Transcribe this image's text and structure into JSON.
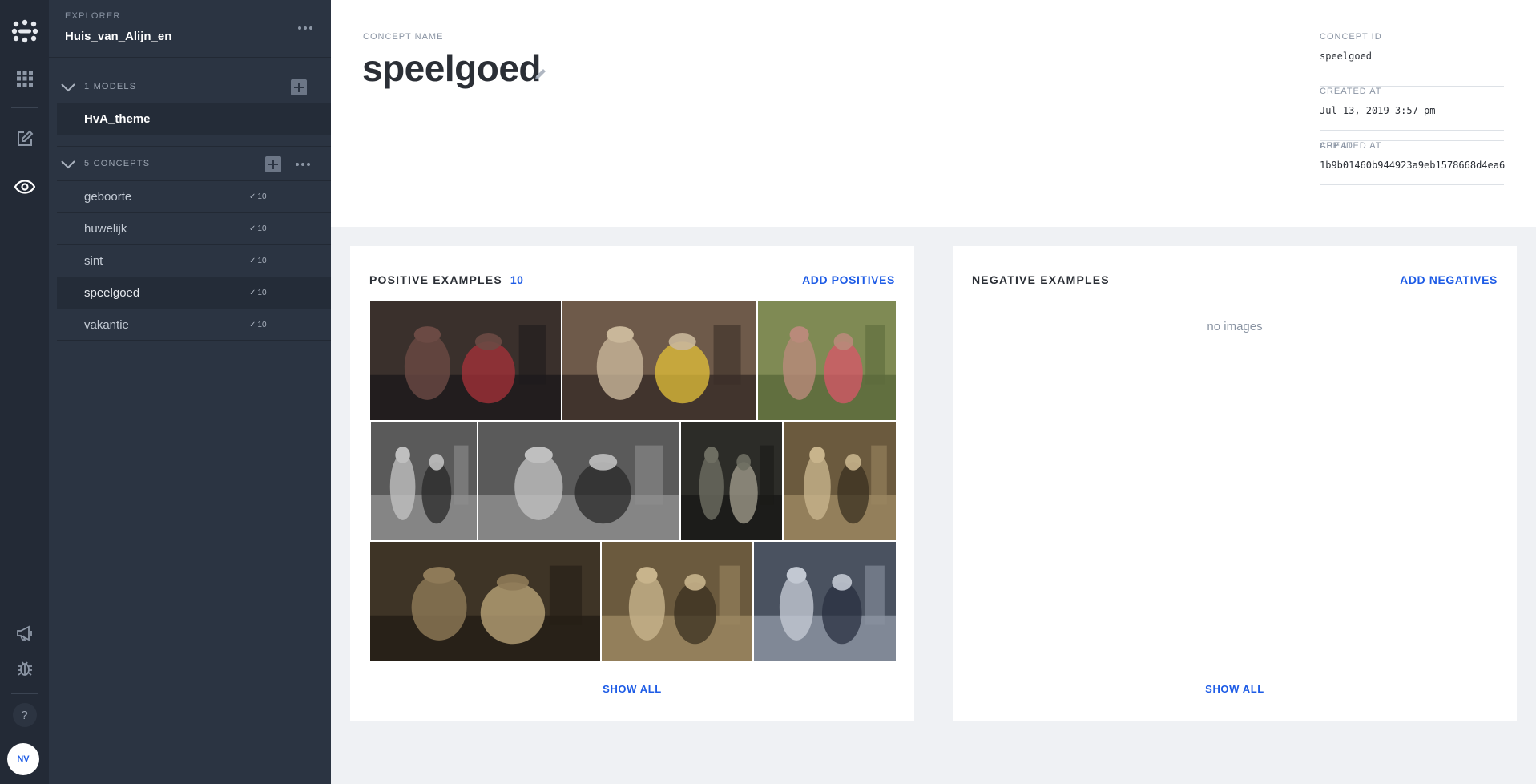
{
  "rail": {
    "icons": [
      "clarifai-logo-icon",
      "apps-grid-icon",
      "edit-icon",
      "eye-icon",
      "megaphone-icon",
      "bug-icon"
    ],
    "help_label": "?",
    "avatar_initials": "NV"
  },
  "explorer": {
    "label": "EXPLORER",
    "app_name": "Huis_van_Alijn_en",
    "models_header": "1 MODELS",
    "models": [
      {
        "name": "HvA_theme"
      }
    ],
    "concepts_header": "5 CONCEPTS",
    "concepts": [
      {
        "name": "geboorte",
        "count": "10",
        "selected": false
      },
      {
        "name": "huwelijk",
        "count": "10",
        "selected": false
      },
      {
        "name": "sint",
        "count": "10",
        "selected": false
      },
      {
        "name": "speelgoed",
        "count": "10",
        "selected": true
      },
      {
        "name": "vakantie",
        "count": "10",
        "selected": false
      }
    ],
    "check_mark": "✓"
  },
  "concept": {
    "name_label": "CONCEPT NAME",
    "name": "speelgoed",
    "meta": [
      {
        "label": "CONCEPT ID",
        "value": "speelgoed"
      },
      {
        "label": "CREATED AT",
        "value": "Jul 13, 2019 3:57 pm"
      },
      {
        "label": "APP ID",
        "value": "1b9b01460b944923a9eb1578668d4ea6"
      }
    ]
  },
  "positive": {
    "title": "POSITIVE EXAMPLES",
    "count": "10",
    "action": "ADD POSITIVES",
    "show_all": "SHOW ALL",
    "thumbnails": [
      {
        "name": "thumb-1",
        "tone": "color-dark"
      },
      {
        "name": "thumb-2",
        "tone": "color-warm"
      },
      {
        "name": "thumb-3",
        "tone": "color-lawn"
      },
      {
        "name": "thumb-4",
        "tone": "bw"
      },
      {
        "name": "thumb-5",
        "tone": "bw"
      },
      {
        "name": "thumb-6",
        "tone": "bw-dark"
      },
      {
        "name": "thumb-7",
        "tone": "sepia"
      },
      {
        "name": "thumb-8",
        "tone": "sepia-dark"
      },
      {
        "name": "thumb-9",
        "tone": "sepia"
      },
      {
        "name": "thumb-10",
        "tone": "bw-blue"
      }
    ]
  },
  "negative": {
    "title": "NEGATIVE EXAMPLES",
    "action": "ADD NEGATIVES",
    "empty_text": "no images",
    "show_all": "SHOW ALL"
  },
  "colors": {
    "accent": "#1e5ce6",
    "rail_bg": "#232a36",
    "sidebar_bg": "#2b3442",
    "page_bg": "#eff1f4"
  }
}
